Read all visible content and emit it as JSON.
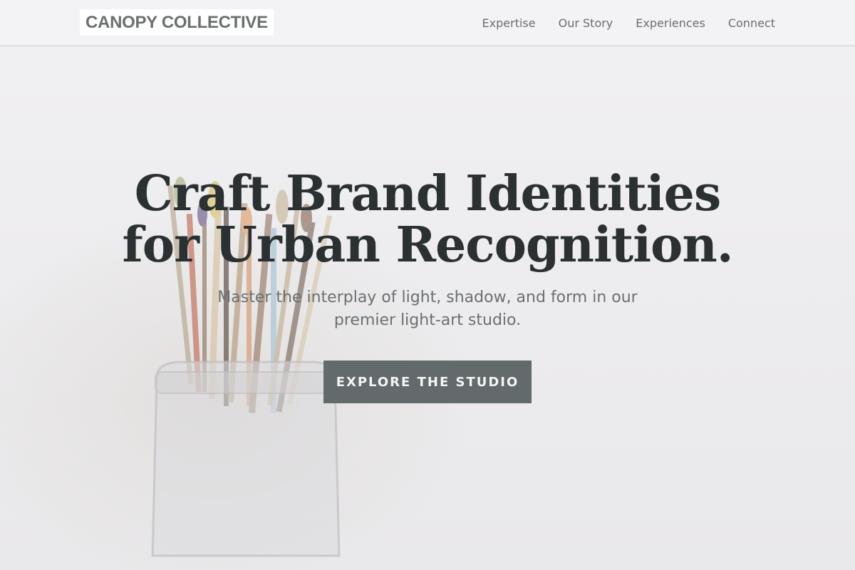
{
  "header": {
    "logo": "CANOPY COLLECTIVE",
    "nav": [
      "Expertise",
      "Our Story",
      "Experiences",
      "Connect"
    ]
  },
  "hero": {
    "title_line1": "Craft Brand Identities",
    "title_line2": "for Urban Recognition.",
    "subtitle_line1": "Master the interplay of light, shadow, and form in our",
    "subtitle_line2": "premier light-art studio.",
    "cta_label": "EXPLORE THE STUDIO",
    "background_image": "paintbrushes-in-glass-jar"
  },
  "colors": {
    "cta_bg": "#626a6b",
    "title": "#2b3133",
    "text_muted": "#6b7072"
  }
}
